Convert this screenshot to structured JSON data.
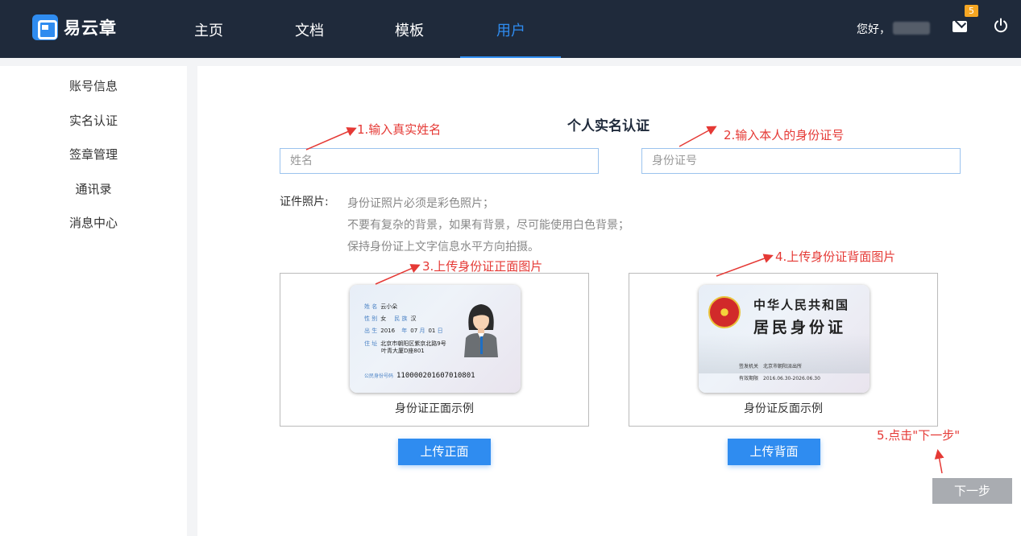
{
  "header": {
    "logo_text": "易云章",
    "nav": [
      {
        "label": "主页",
        "active": false
      },
      {
        "label": "文档",
        "active": false
      },
      {
        "label": "模板",
        "active": false
      },
      {
        "label": "用户",
        "active": true
      }
    ],
    "greeting": "您好，",
    "mail_count": "5"
  },
  "sidebar": {
    "items": [
      {
        "label": "账号信息"
      },
      {
        "label": "实名认证"
      },
      {
        "label": "签章管理"
      },
      {
        "label": "通讯录"
      },
      {
        "label": "消息中心"
      }
    ]
  },
  "main": {
    "title": "个人实名认证",
    "name_placeholder": "姓名",
    "id_placeholder": "身份证号",
    "photo_label": "证件照片:",
    "requirements": [
      "身份证照片必须是彩色照片；",
      "不要有复杂的背景，如果有背景，尽可能使用白色背景；",
      "保持身份证上文字信息水平方向拍摄。"
    ],
    "front_card": {
      "caption": "身份证正面示例",
      "name_label": "姓 名",
      "name": "云小朵",
      "sex_label": "性 别",
      "sex": "女",
      "nation_label": "民 族",
      "nation": "汉",
      "birth_label": "出 生",
      "birth_year": "2016",
      "year_unit": "年",
      "birth_month": "07",
      "month_unit": "月",
      "birth_day": "01",
      "day_unit": "日",
      "address_label": "住 址",
      "address_line1": "北京市朝阳区紫京北路9号",
      "address_line2": "叶青大厦D座801",
      "id_label": "公民身份号码",
      "id_number": "110000201607010801"
    },
    "back_card": {
      "caption": "身份证反面示例",
      "title_line1": "中华人民共和国",
      "title_line2": "居民身份证",
      "authority_label": "签发机关",
      "authority": "北京市朝阳派出所",
      "validity_label": "有效期限",
      "validity": "2016.06.30-2026.06.30"
    },
    "upload_front_label": "上传正面",
    "upload_back_label": "上传背面",
    "next_label": "下一步"
  },
  "annotations": {
    "step1": "1.输入真实姓名",
    "step2": "2.输入本人的身份证号",
    "step3": "3.上传身份证正面图片",
    "step4": "4.上传身份证背面图片",
    "step5": "5.点击\"下一步\"",
    "color": "#e53935"
  },
  "colors": {
    "topbar": "#1f2a3b",
    "accent": "#2f8cf0",
    "badge": "#f5a623",
    "next_button": "#a9acb1"
  }
}
